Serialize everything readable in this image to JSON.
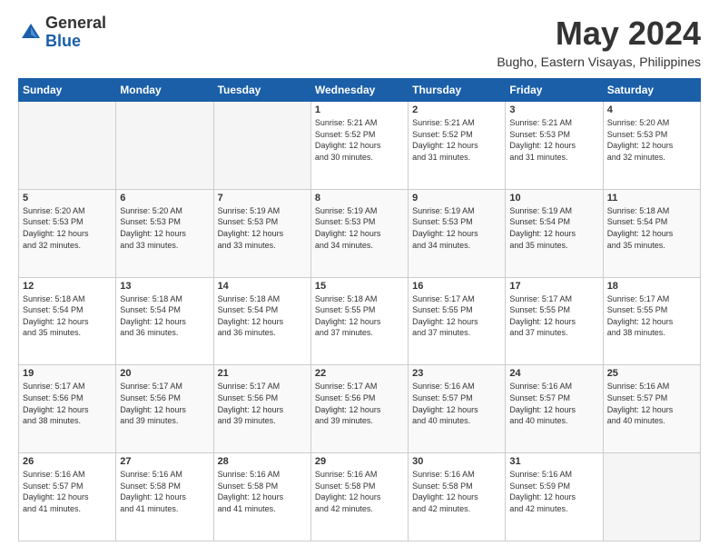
{
  "logo": {
    "general": "General",
    "blue": "Blue"
  },
  "title": "May 2024",
  "subtitle": "Bugho, Eastern Visayas, Philippines",
  "headers": [
    "Sunday",
    "Monday",
    "Tuesday",
    "Wednesday",
    "Thursday",
    "Friday",
    "Saturday"
  ],
  "weeks": [
    [
      {
        "day": "",
        "info": ""
      },
      {
        "day": "",
        "info": ""
      },
      {
        "day": "",
        "info": ""
      },
      {
        "day": "1",
        "info": "Sunrise: 5:21 AM\nSunset: 5:52 PM\nDaylight: 12 hours\nand 30 minutes."
      },
      {
        "day": "2",
        "info": "Sunrise: 5:21 AM\nSunset: 5:52 PM\nDaylight: 12 hours\nand 31 minutes."
      },
      {
        "day": "3",
        "info": "Sunrise: 5:21 AM\nSunset: 5:53 PM\nDaylight: 12 hours\nand 31 minutes."
      },
      {
        "day": "4",
        "info": "Sunrise: 5:20 AM\nSunset: 5:53 PM\nDaylight: 12 hours\nand 32 minutes."
      }
    ],
    [
      {
        "day": "5",
        "info": "Sunrise: 5:20 AM\nSunset: 5:53 PM\nDaylight: 12 hours\nand 32 minutes."
      },
      {
        "day": "6",
        "info": "Sunrise: 5:20 AM\nSunset: 5:53 PM\nDaylight: 12 hours\nand 33 minutes."
      },
      {
        "day": "7",
        "info": "Sunrise: 5:19 AM\nSunset: 5:53 PM\nDaylight: 12 hours\nand 33 minutes."
      },
      {
        "day": "8",
        "info": "Sunrise: 5:19 AM\nSunset: 5:53 PM\nDaylight: 12 hours\nand 34 minutes."
      },
      {
        "day": "9",
        "info": "Sunrise: 5:19 AM\nSunset: 5:53 PM\nDaylight: 12 hours\nand 34 minutes."
      },
      {
        "day": "10",
        "info": "Sunrise: 5:19 AM\nSunset: 5:54 PM\nDaylight: 12 hours\nand 35 minutes."
      },
      {
        "day": "11",
        "info": "Sunrise: 5:18 AM\nSunset: 5:54 PM\nDaylight: 12 hours\nand 35 minutes."
      }
    ],
    [
      {
        "day": "12",
        "info": "Sunrise: 5:18 AM\nSunset: 5:54 PM\nDaylight: 12 hours\nand 35 minutes."
      },
      {
        "day": "13",
        "info": "Sunrise: 5:18 AM\nSunset: 5:54 PM\nDaylight: 12 hours\nand 36 minutes."
      },
      {
        "day": "14",
        "info": "Sunrise: 5:18 AM\nSunset: 5:54 PM\nDaylight: 12 hours\nand 36 minutes."
      },
      {
        "day": "15",
        "info": "Sunrise: 5:18 AM\nSunset: 5:55 PM\nDaylight: 12 hours\nand 37 minutes."
      },
      {
        "day": "16",
        "info": "Sunrise: 5:17 AM\nSunset: 5:55 PM\nDaylight: 12 hours\nand 37 minutes."
      },
      {
        "day": "17",
        "info": "Sunrise: 5:17 AM\nSunset: 5:55 PM\nDaylight: 12 hours\nand 37 minutes."
      },
      {
        "day": "18",
        "info": "Sunrise: 5:17 AM\nSunset: 5:55 PM\nDaylight: 12 hours\nand 38 minutes."
      }
    ],
    [
      {
        "day": "19",
        "info": "Sunrise: 5:17 AM\nSunset: 5:56 PM\nDaylight: 12 hours\nand 38 minutes."
      },
      {
        "day": "20",
        "info": "Sunrise: 5:17 AM\nSunset: 5:56 PM\nDaylight: 12 hours\nand 39 minutes."
      },
      {
        "day": "21",
        "info": "Sunrise: 5:17 AM\nSunset: 5:56 PM\nDaylight: 12 hours\nand 39 minutes."
      },
      {
        "day": "22",
        "info": "Sunrise: 5:17 AM\nSunset: 5:56 PM\nDaylight: 12 hours\nand 39 minutes."
      },
      {
        "day": "23",
        "info": "Sunrise: 5:16 AM\nSunset: 5:57 PM\nDaylight: 12 hours\nand 40 minutes."
      },
      {
        "day": "24",
        "info": "Sunrise: 5:16 AM\nSunset: 5:57 PM\nDaylight: 12 hours\nand 40 minutes."
      },
      {
        "day": "25",
        "info": "Sunrise: 5:16 AM\nSunset: 5:57 PM\nDaylight: 12 hours\nand 40 minutes."
      }
    ],
    [
      {
        "day": "26",
        "info": "Sunrise: 5:16 AM\nSunset: 5:57 PM\nDaylight: 12 hours\nand 41 minutes."
      },
      {
        "day": "27",
        "info": "Sunrise: 5:16 AM\nSunset: 5:58 PM\nDaylight: 12 hours\nand 41 minutes."
      },
      {
        "day": "28",
        "info": "Sunrise: 5:16 AM\nSunset: 5:58 PM\nDaylight: 12 hours\nand 41 minutes."
      },
      {
        "day": "29",
        "info": "Sunrise: 5:16 AM\nSunset: 5:58 PM\nDaylight: 12 hours\nand 42 minutes."
      },
      {
        "day": "30",
        "info": "Sunrise: 5:16 AM\nSunset: 5:58 PM\nDaylight: 12 hours\nand 42 minutes."
      },
      {
        "day": "31",
        "info": "Sunrise: 5:16 AM\nSunset: 5:59 PM\nDaylight: 12 hours\nand 42 minutes."
      },
      {
        "day": "",
        "info": ""
      }
    ]
  ]
}
